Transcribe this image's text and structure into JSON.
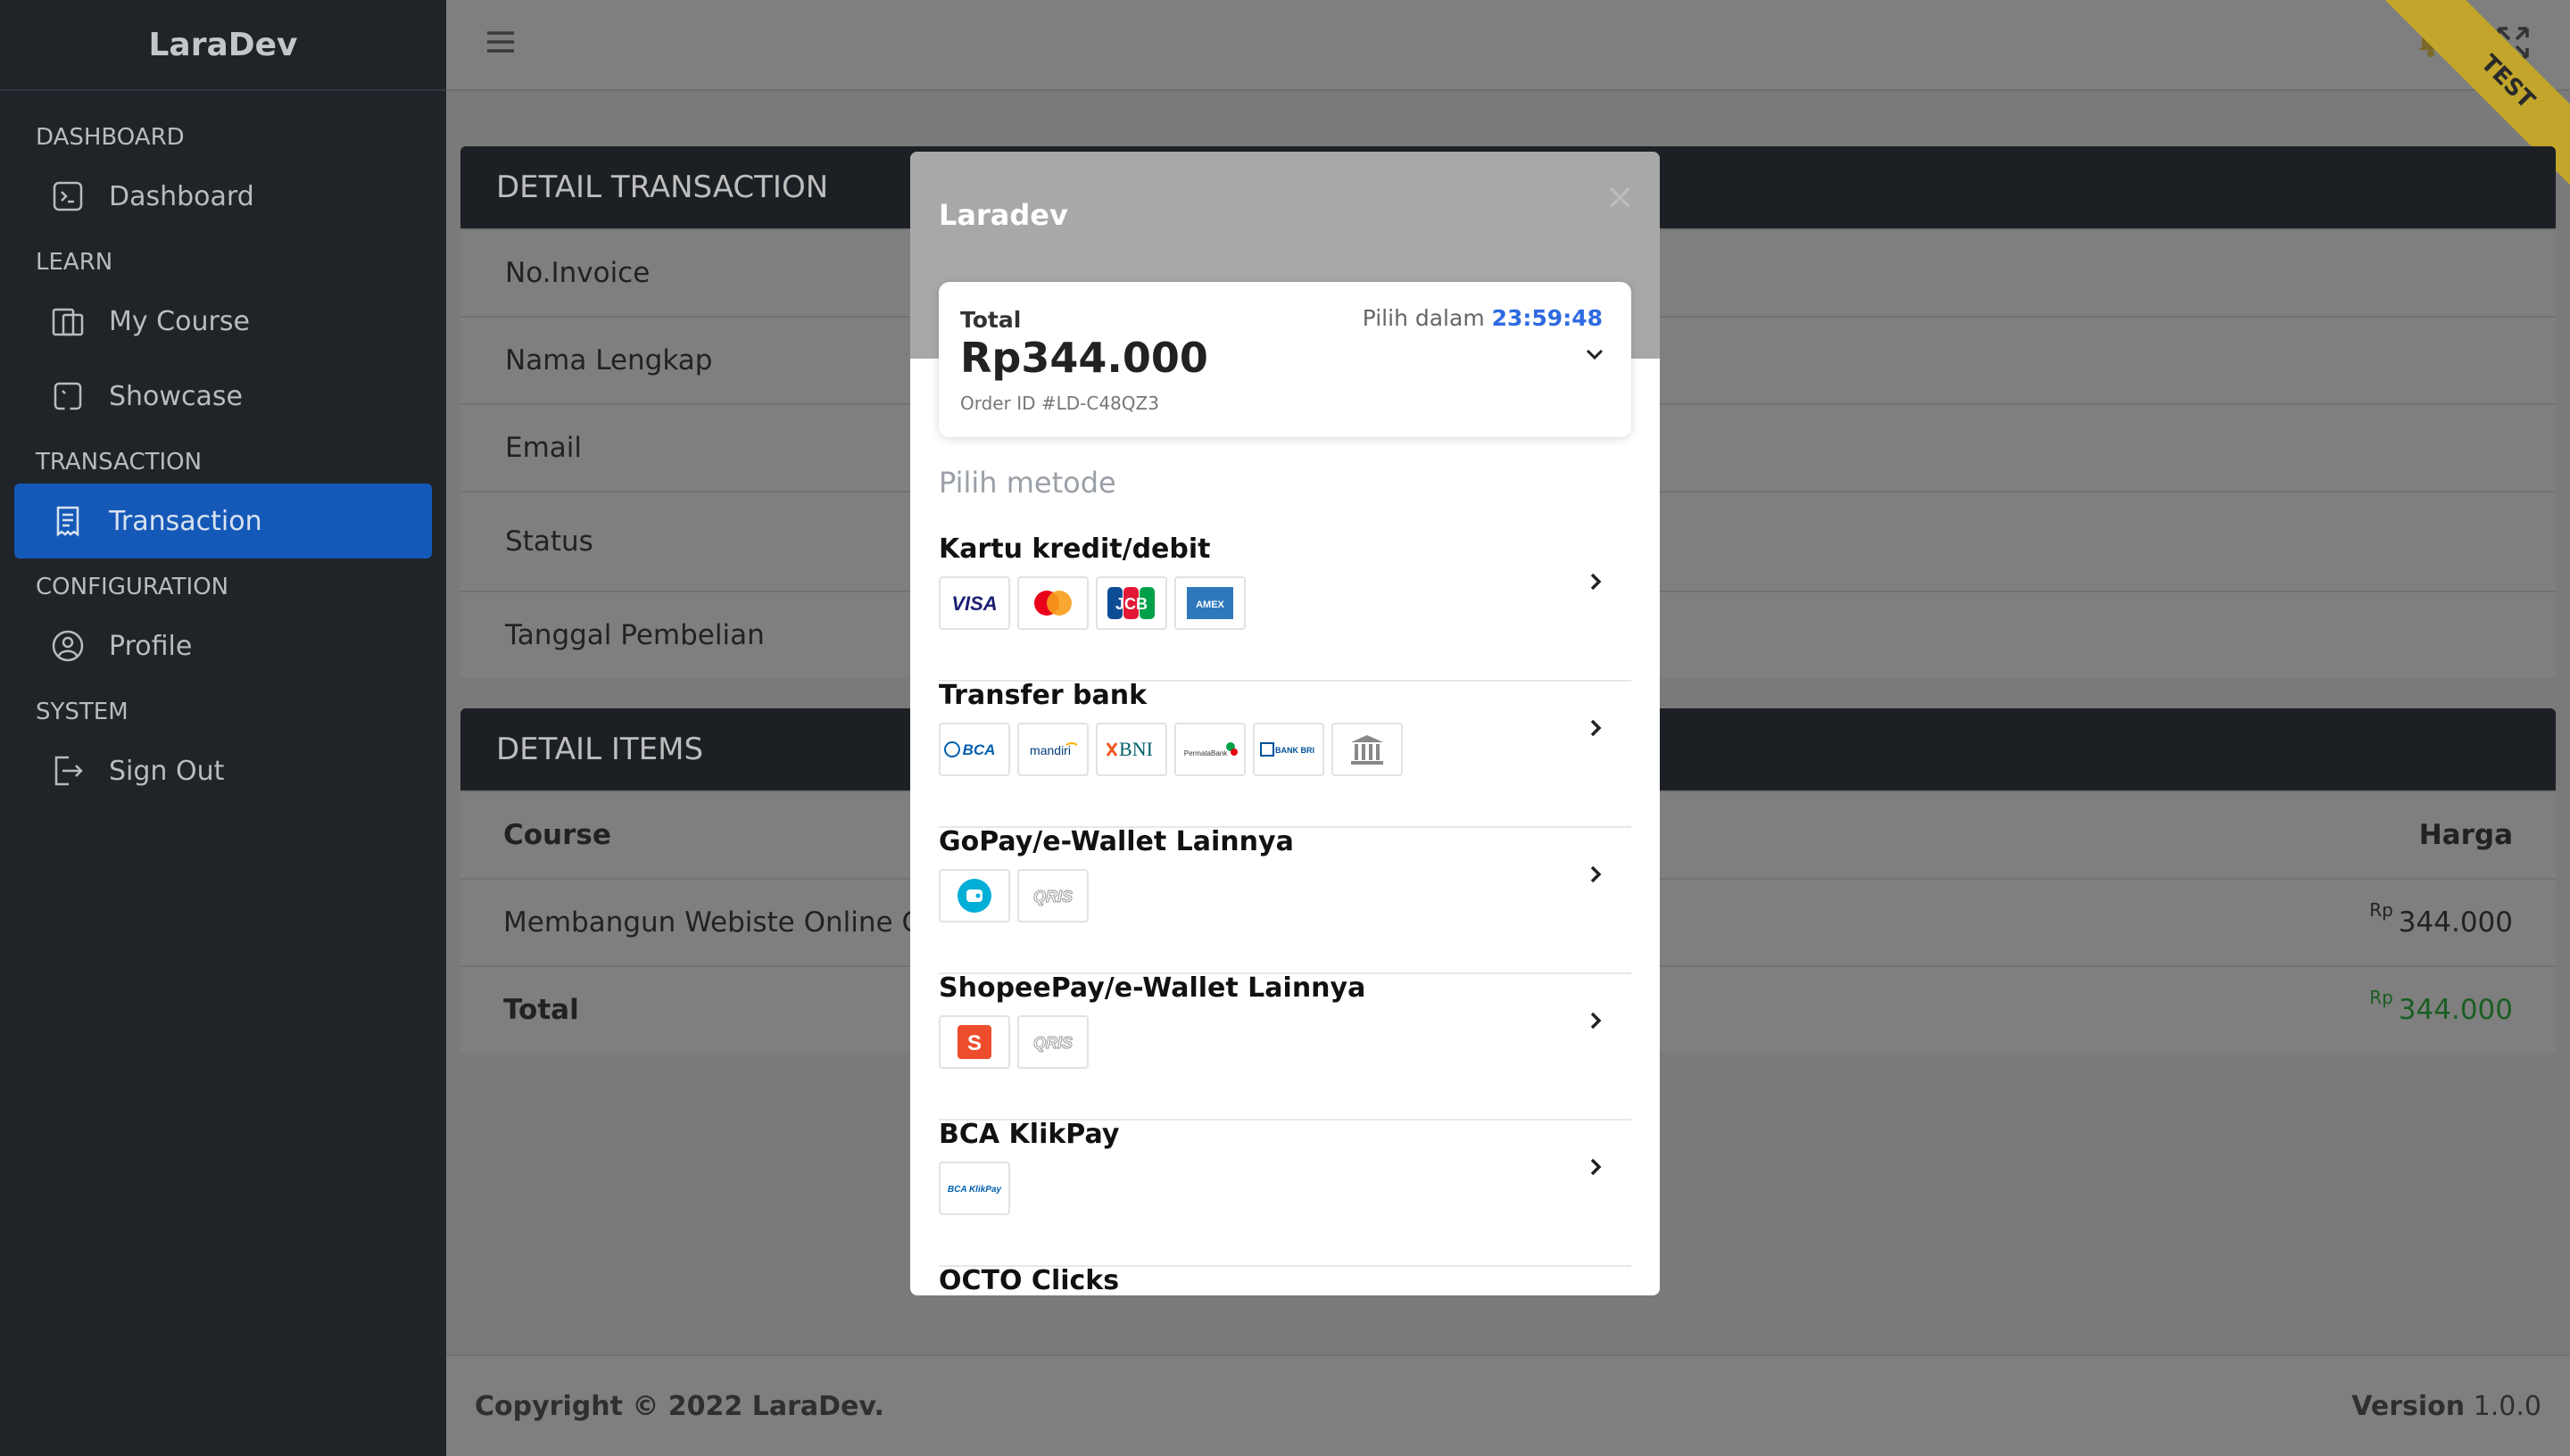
{
  "sidebar": {
    "brand": "LaraDev",
    "sections": [
      {
        "header": "DASHBOARD",
        "items": [
          {
            "label": "Dashboard",
            "icon": "terminal-icon"
          }
        ]
      },
      {
        "header": "LEARN",
        "items": [
          {
            "label": "My Course",
            "icon": "course-icon"
          },
          {
            "label": "Showcase",
            "icon": "showcase-icon"
          }
        ]
      },
      {
        "header": "TRANSACTION",
        "items": [
          {
            "label": "Transaction",
            "icon": "receipt-icon",
            "active": true
          }
        ]
      },
      {
        "header": "CONFIGURATION",
        "items": [
          {
            "label": "Profile",
            "icon": "user-circle-icon"
          }
        ]
      },
      {
        "header": "SYSTEM",
        "items": [
          {
            "label": "Sign Out",
            "icon": "sign-out-icon"
          }
        ]
      }
    ],
    "active_color": "#1559b8"
  },
  "ribbon": "TEST",
  "detail_transaction": {
    "title": "DETAIL TRANSACTION",
    "rows": [
      "No.Invoice",
      "Nama Lengkap",
      "Email",
      "Status",
      "Tanggal Pembelian"
    ]
  },
  "detail_items": {
    "title": "DETAIL ITEMS",
    "col_course": "Course",
    "col_harga": "Harga",
    "item_course": "Membangun Webiste Online Cours",
    "item_currency": "Rp",
    "item_price": "344.000",
    "total_label": "Total",
    "total_currency": "Rp",
    "total_price": "344.000"
  },
  "footer": {
    "copyright": "Copyright © 2022 LaraDev.",
    "version_label": "Version",
    "version_value": "1.0.0"
  },
  "modal": {
    "title": "Laradev",
    "close": "×",
    "total_label": "Total",
    "amount": "Rp344.000",
    "order_id": "Order ID #LD-C48QZ3",
    "time_label": "Pilih dalam",
    "time_value": "23:59:48",
    "pilih_metode": "Pilih metode",
    "methods": [
      {
        "title": "Kartu kredit/debit",
        "logos": [
          "VISA",
          "mastercard",
          "JCB",
          "AMEX"
        ]
      },
      {
        "title": "Transfer bank",
        "logos": [
          "BCA",
          "mandiri",
          "BNI",
          "PermataBank",
          "BANK BRI",
          "bank-icon"
        ]
      },
      {
        "title": "GoPay/e-Wallet Lainnya",
        "logos": [
          "gopay",
          "QRIS"
        ]
      },
      {
        "title": "ShopeePay/e-Wallet Lainnya",
        "logos": [
          "shopeepay",
          "QRIS"
        ]
      },
      {
        "title": "BCA KlikPay",
        "logos": [
          "BCA KlikPay"
        ]
      },
      {
        "title": "OCTO Clicks",
        "logos": []
      }
    ],
    "time_color": "#2f6ae0"
  }
}
